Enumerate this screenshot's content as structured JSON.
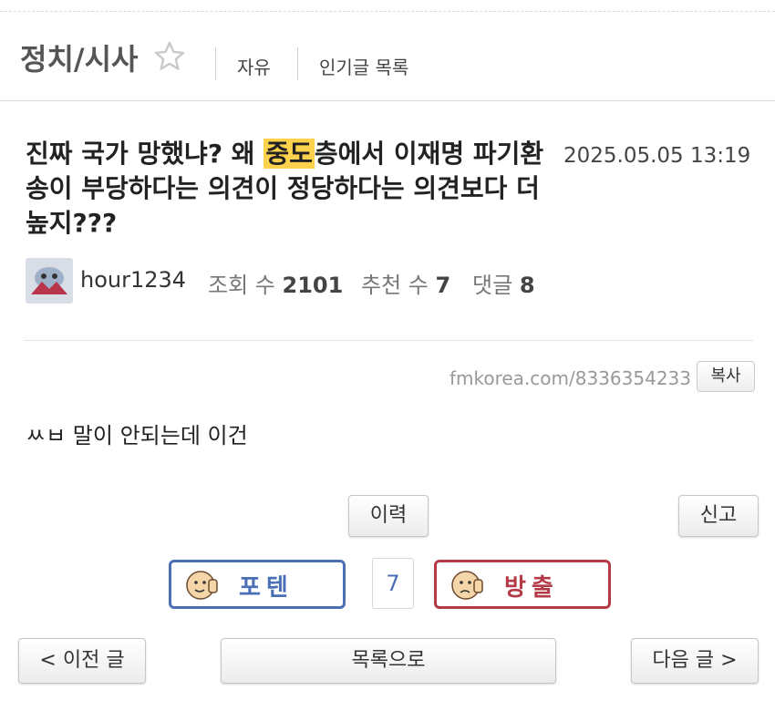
{
  "header": {
    "board_title": "정치/시사",
    "nav": [
      "자유",
      "인기글 목록"
    ]
  },
  "post": {
    "title_before": "진짜 국가 망했냐? 왜 ",
    "title_highlight": "중도",
    "title_after": "층에서 이재명 파기환송이 부당하다는 의견이 정당하다는 의견보다 더 높지???",
    "date": "2025.05.05 13:19",
    "author": "hour1234",
    "views_label": "조회 수",
    "views": "2101",
    "likes_label": "추천 수",
    "likes": "7",
    "comments_label": "댓글",
    "comments": "8",
    "url": "fmkorea.com/8336354233",
    "copy_label": "복사",
    "body": "ㅆㅂ 말이 안되는데 이건"
  },
  "actions": {
    "history_label": "이력",
    "report_label": "신고",
    "upvote_label": "포텐",
    "vote_count": "7",
    "downvote_label": "방출",
    "prev_label": "< 이전 글",
    "list_label": "목록으로",
    "next_label": "다음 글 >"
  },
  "colors": {
    "highlight": "#ffd24d",
    "upvote": "#4a6fb5",
    "downvote": "#b33a46"
  }
}
